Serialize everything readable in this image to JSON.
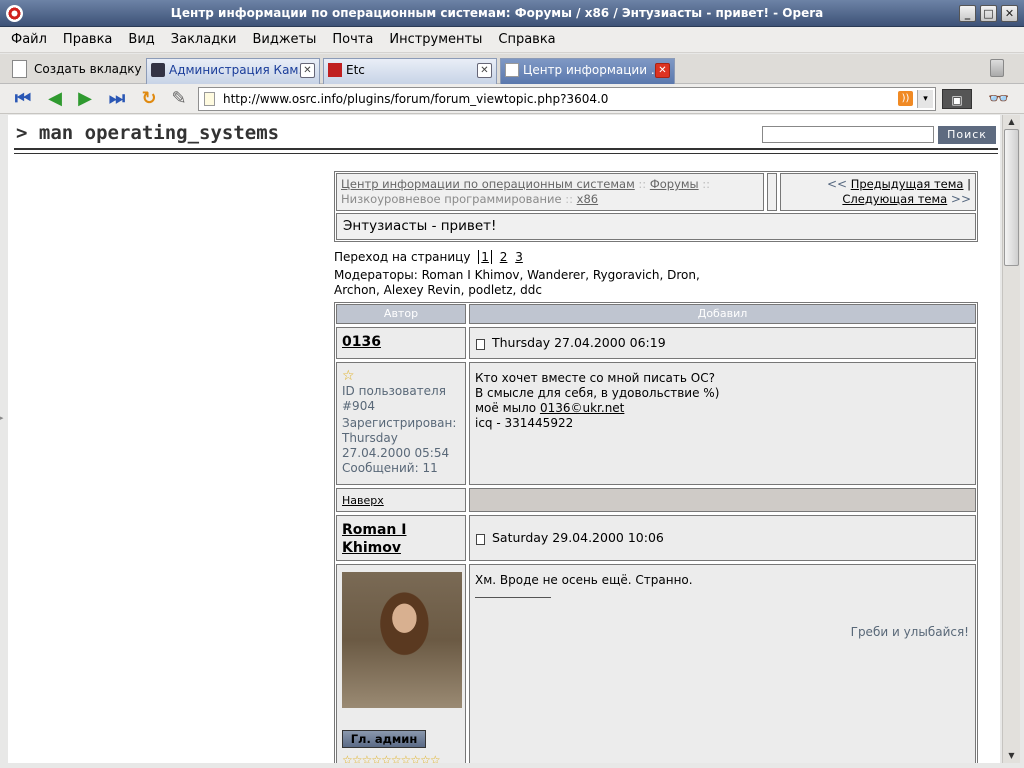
{
  "window": {
    "title": "Центр информации по операционным системам: Форумы / x86 / Энтузиасты - привет! - Opera",
    "btn_minimize": "_",
    "btn_maximize": "□",
    "btn_close": "✕"
  },
  "menu": [
    "Файл",
    "Правка",
    "Вид",
    "Закладки",
    "Виджеты",
    "Почта",
    "Инструменты",
    "Справка"
  ],
  "tabs": {
    "new_tab": "Создать вкладку",
    "items": [
      {
        "label": "Администрация Кам...",
        "icon": "car-icon"
      },
      {
        "label": "Etc",
        "icon": "etc-icon"
      },
      {
        "label": "Центр информации ...",
        "icon": "page-icon"
      }
    ],
    "close_glyph": "✕"
  },
  "nav": {
    "back2": "⏮",
    "back": "◀",
    "forward": "▶",
    "forward2": "⏭",
    "reload": "↻",
    "edit": "✎",
    "url": "http://www.osrc.info/plugins/forum/forum_viewtopic.php?3604.0",
    "rss": "))",
    "dropdown": "▾",
    "readers": "👓"
  },
  "site": {
    "title": "> man operating_systems",
    "search_button": "Поиск"
  },
  "forum": {
    "breadcrumb": {
      "home": "Центр информации по операционным системам",
      "sep": "::",
      "forums": "Форумы",
      "subforum": "Низкоуровневое программирование",
      "current": "x86"
    },
    "nav": {
      "prev_arrow": "<<",
      "prev": "Предыдущая тема",
      "bar": "|",
      "next": "Следующая тема",
      "next_arrow": ">>"
    },
    "topic_title": "Энтузиасты - привет!",
    "pages_label": "Переход на страницу",
    "pages": [
      "1",
      "2",
      "3"
    ],
    "moderators": "Модераторы: Roman I Khimov, Wanderer, Rygoravich, Dron, Archon, Alexey Revin, podletz, ddc",
    "col_author": "Автор",
    "col_added": "Добавил",
    "to_top": "Наверх"
  },
  "posts": [
    {
      "author": "0136",
      "date": "Thursday 27.04.2000 06:19",
      "star": "☆",
      "user_id_label": "ID пользователя",
      "user_id": "#904",
      "registered_label": "Зарегистрирован:",
      "registered": "Thursday 27.04.2000 05:54",
      "posts_label": "Сообщений: 11",
      "lines": [
        "Кто хочет вместе со мной писать ОС?",
        "В смысле для себя, в удовольствие %)"
      ],
      "email_prefix": "моё мыло ",
      "email": "0136©ukr.net",
      "icq": "icq - 331445922"
    },
    {
      "author": "Roman I Khimov",
      "date": "Saturday 29.04.2000 10:06",
      "badge": "Гл. админ",
      "stars": "☆☆☆☆☆☆☆☆☆☆",
      "text": "Хм. Вроде не осень ещё. Странно.",
      "signature": "Греби и улыбайся!"
    }
  ]
}
